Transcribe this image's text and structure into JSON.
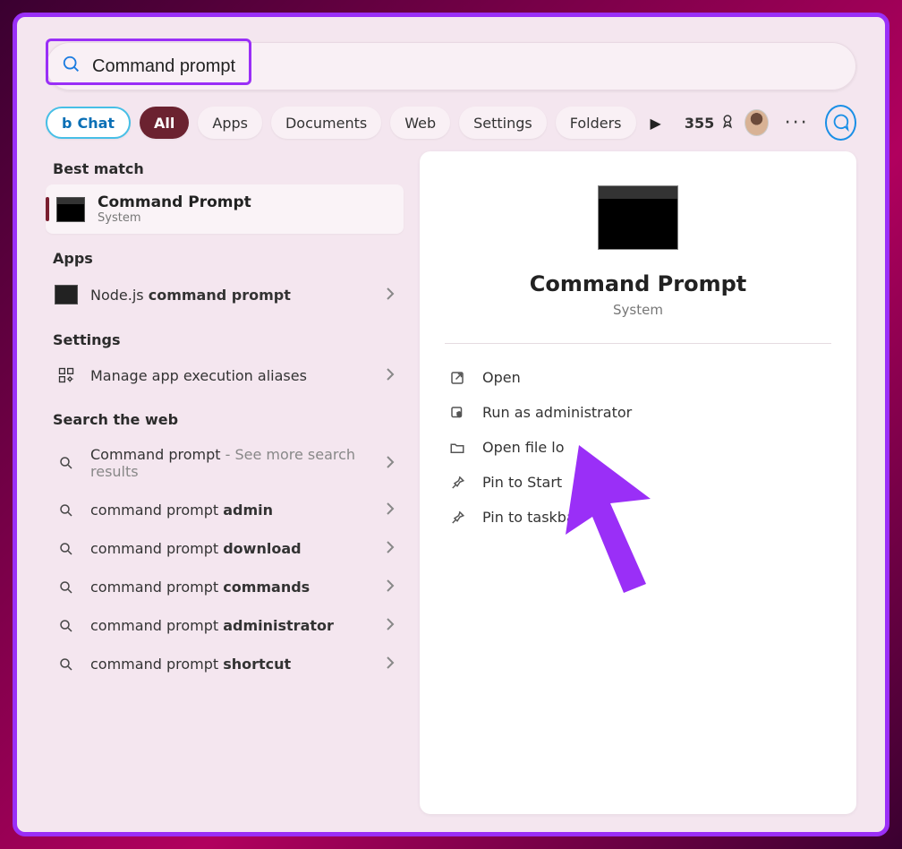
{
  "search": {
    "value": "Command prompt"
  },
  "filters": {
    "chat": "Chat",
    "all": "All",
    "apps": "Apps",
    "documents": "Documents",
    "web": "Web",
    "settings": "Settings",
    "folders": "Folders"
  },
  "rewards": {
    "count": "355"
  },
  "left": {
    "bestMatchLabel": "Best match",
    "bestMatch": {
      "title": "Command Prompt",
      "subtitle": "System"
    },
    "appsLabel": "Apps",
    "apps_item": {
      "prefix": "Node.js ",
      "bold": "command prompt"
    },
    "settingsLabel": "Settings",
    "settings_item": "Manage app execution aliases",
    "webLabel": "Search the web",
    "web1": {
      "prefix": "Command prompt",
      "sub": " - See more search results"
    },
    "web2": {
      "prefix": "command prompt ",
      "bold": "admin"
    },
    "web3": {
      "prefix": "command prompt ",
      "bold": "download"
    },
    "web4": {
      "prefix": "command prompt ",
      "bold": "commands"
    },
    "web5": {
      "prefix": "command prompt ",
      "bold": "administrator"
    },
    "web6": {
      "prefix": "command prompt ",
      "bold": "shortcut"
    }
  },
  "right": {
    "title": "Command Prompt",
    "subtitle": "System",
    "actions": {
      "open": "Open",
      "runAdmin": "Run as administrator",
      "openLoc": "Open file lo",
      "pinStart": "Pin to Start",
      "pinTaskbar": "Pin to taskbar"
    }
  }
}
